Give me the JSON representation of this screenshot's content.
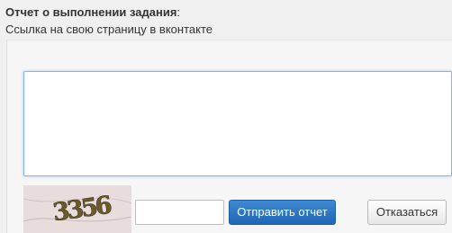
{
  "form": {
    "title": "Отчет о выполнении задания",
    "title_colon": ":",
    "subtitle": "Ссылка на свою страницу в вконтакте",
    "report_value": "",
    "captcha_input_value": "",
    "captcha_text": "3356"
  },
  "buttons": {
    "submit_label": "Отправить отчет",
    "decline_label": "Отказаться"
  },
  "colors": {
    "submit_bg": "#1f66b4",
    "focus_border": "#86b6e6",
    "captcha_bg": "#e8dcdc"
  }
}
